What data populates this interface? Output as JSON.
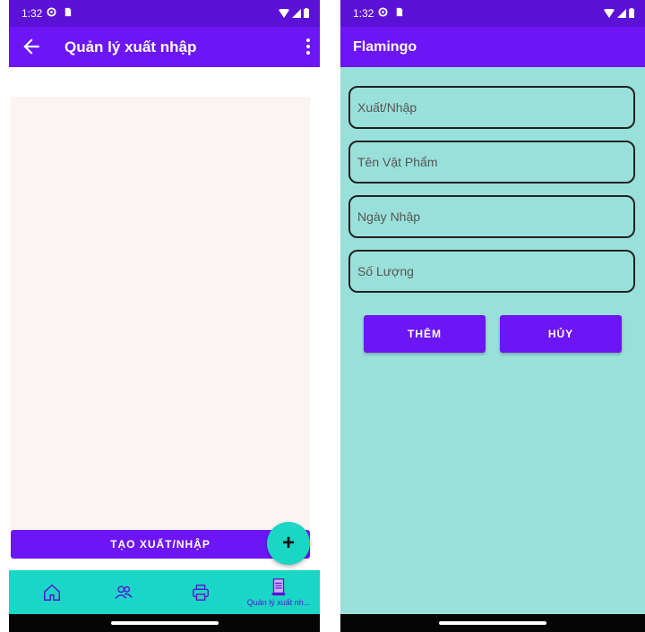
{
  "left_screen": {
    "status": {
      "time": "1:32"
    },
    "appbar": {
      "title": "Quản lý xuất nhập"
    },
    "create_button_label": "TẠO XUẤT/NHẬP",
    "fab_label": "+",
    "bottom_nav": {
      "items": [
        {
          "icon": "home-icon",
          "label": ""
        },
        {
          "icon": "people-icon",
          "label": ""
        },
        {
          "icon": "printer-icon",
          "label": ""
        },
        {
          "icon": "document-list-icon",
          "label": "Quản lý xuất nh..."
        }
      ]
    }
  },
  "right_screen": {
    "status": {
      "time": "1:32"
    },
    "appbar": {
      "title": "Flamingo"
    },
    "form": {
      "fields": [
        {
          "placeholder": "Xuất/Nhập",
          "value": ""
        },
        {
          "placeholder": "Tên Vật Phẩm",
          "value": ""
        },
        {
          "placeholder": "Ngày Nhập",
          "value": ""
        },
        {
          "placeholder": "Số Lượng",
          "value": ""
        }
      ],
      "add_button_label": "THÊM",
      "cancel_button_label": "HỦY"
    }
  },
  "colors": {
    "status_bar": "#5c11d6",
    "app_bar": "#6d16f5",
    "primary_button": "#6d16f5",
    "fab": "#19d6c5",
    "bottom_nav": "#1ad6c6",
    "form_background": "#9ae0da",
    "list_background": "#faf4f3"
  }
}
